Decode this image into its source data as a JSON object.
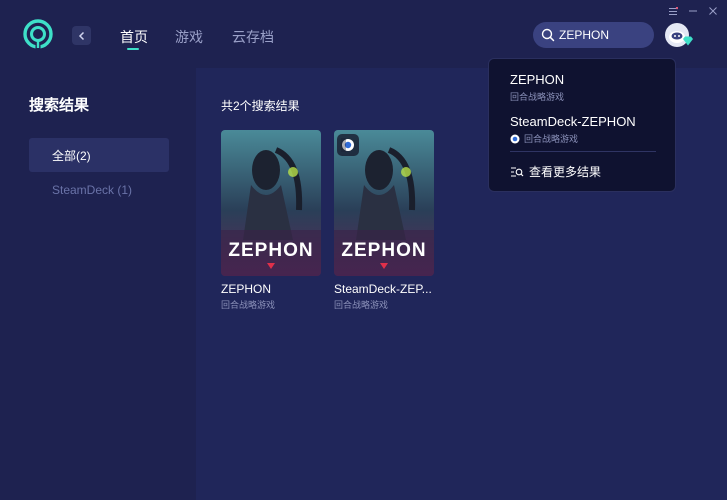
{
  "header": {
    "nav_tabs": [
      {
        "label": "首页",
        "active": true
      },
      {
        "label": "游戏",
        "active": false
      },
      {
        "label": "云存档",
        "active": false
      }
    ],
    "search_value": "ZEPHON",
    "accent_color": "#3ee0c8"
  },
  "sidebar": {
    "title": "搜索结果",
    "items": [
      {
        "label": "全部(2)",
        "active": true
      },
      {
        "label": "SteamDeck (1)",
        "active": false
      }
    ]
  },
  "main": {
    "result_count": "共2个搜索结果",
    "cards": [
      {
        "title": "ZEPHON",
        "subtitle": "回合战略游戏",
        "cover_text": "ZEPHON",
        "steamdeck": false
      },
      {
        "title": "SteamDeck-ZEP...",
        "subtitle": "回合战略游戏",
        "cover_text": "ZEPHON",
        "steamdeck": true
      }
    ]
  },
  "dropdown": {
    "items": [
      {
        "title": "ZEPHON",
        "subtitle": "回合战略游戏",
        "steamdeck": false
      },
      {
        "title": "SteamDeck-ZEPHON",
        "subtitle": "回合战略游戏",
        "steamdeck": true
      }
    ],
    "more_label": "查看更多结果"
  }
}
